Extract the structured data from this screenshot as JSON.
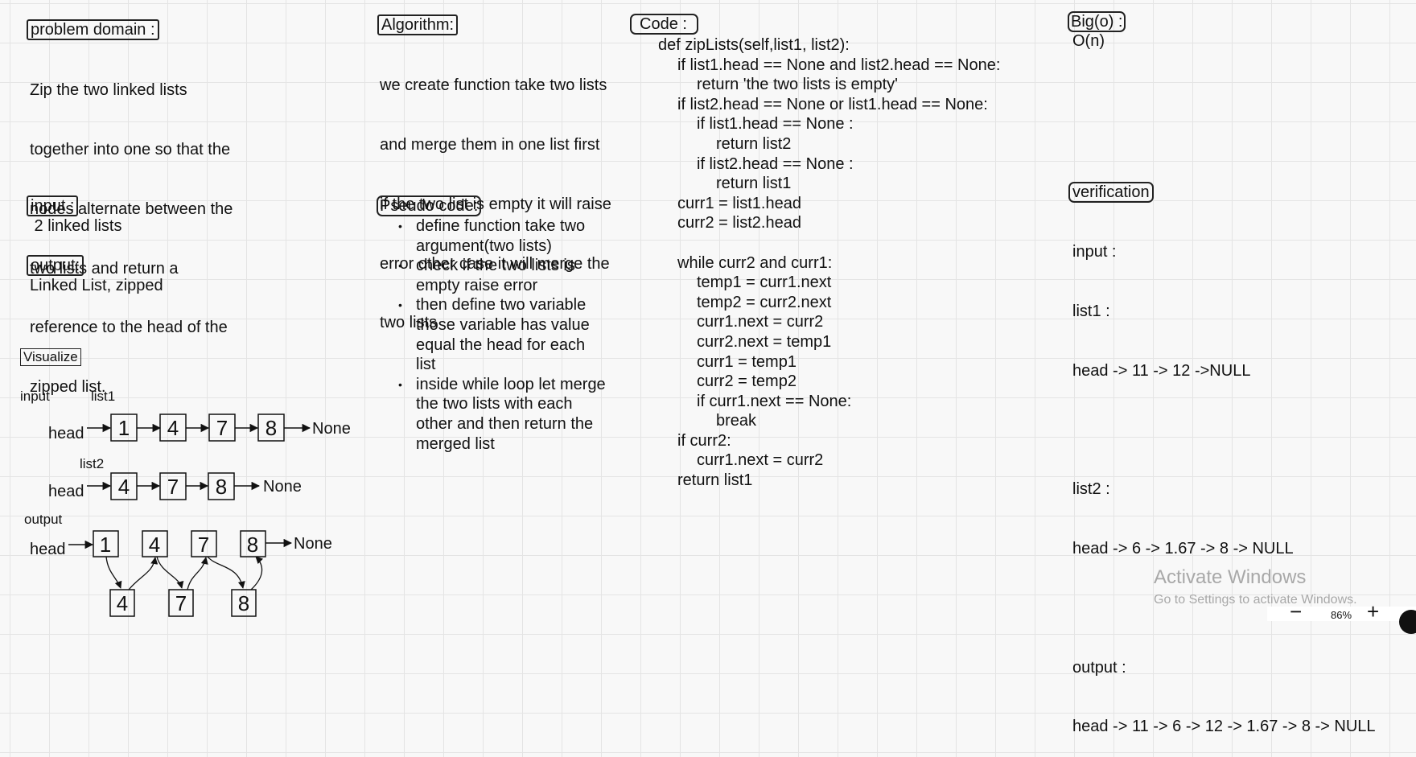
{
  "problem_domain": {
    "title": "problem domain :",
    "lines": [
      "Zip the two linked lists",
      "together into one so that the",
      "nodes alternate between the",
      "two lists and return a",
      "reference to the head of the",
      "zipped list."
    ]
  },
  "input_section": {
    "title": "input :",
    "value": " 2 linked lists"
  },
  "output_section": {
    "title": "output:",
    "value": "Linked List, zipped"
  },
  "visualize": {
    "title": "Visualize",
    "input_label": "input",
    "list1_label": "list1",
    "list2_label": "list2",
    "output_label": "output",
    "head_label": "head",
    "none_label": "None",
    "list1": [
      "1",
      "4",
      "7",
      "8"
    ],
    "list2": [
      "4",
      "7",
      "8"
    ],
    "output_top": [
      "1",
      "4",
      "7",
      "8"
    ],
    "output_bottom": [
      "4",
      "7",
      "8"
    ]
  },
  "algorithm": {
    "title": "Algorithm:",
    "lines": [
      "we create function take two lists",
      "and merge them in one list first",
      "if the two list is empty it will raise",
      "error other case it will merge the",
      "two lists"
    ]
  },
  "pseudo": {
    "title": "Pseudo code:",
    "items": [
      [
        "define function take two",
        "argument(two lists)"
      ],
      [
        "check if the two lists is",
        "empty raise error"
      ],
      [
        "then define two variable",
        "those variable has value",
        "equal the head for each",
        "list"
      ],
      [
        "inside while loop let merge",
        "the two lists with each",
        "other and then return the",
        "merged list"
      ]
    ]
  },
  "code": {
    "title": "Code :",
    "lines": [
      "def zipLists(self,list1, list2):",
      "if list1.head == None and list2.head == None:",
      "return 'the two lists is empty'",
      "if list2.head == None or list1.head == None:",
      "if list1.head == None :",
      "return list2",
      "if list2.head == None :",
      "return list1",
      "curr1 = list1.head",
      "curr2 = list2.head",
      "",
      "while curr2 and curr1:",
      "temp1 = curr1.next",
      "temp2 = curr2.next",
      "curr1.next = curr2",
      "curr2.next = temp1",
      "curr1 = temp1",
      "curr2 = temp2",
      "if curr1.next == None:",
      "break",
      "if curr2:",
      "curr1.next = curr2",
      "return list1"
    ]
  },
  "bigo": {
    "title": "Big(o) :",
    "value": "O(n)"
  },
  "verification": {
    "title": "verification",
    "lines": [
      "input :",
      "list1 :",
      "head -> 11 -> 12 ->NULL",
      "",
      "list2 :",
      "head -> 6 -> 1.67 -> 8 -> NULL",
      "",
      "output :",
      "head -> 11 -> 6 -> 12 -> 1.67 -> 8 -> NULL"
    ]
  },
  "watermark": {
    "title": "Activate Windows",
    "subtitle": "Go to Settings to activate Windows."
  },
  "zoom": {
    "minus": "−",
    "value": "86%",
    "plus": "+"
  }
}
